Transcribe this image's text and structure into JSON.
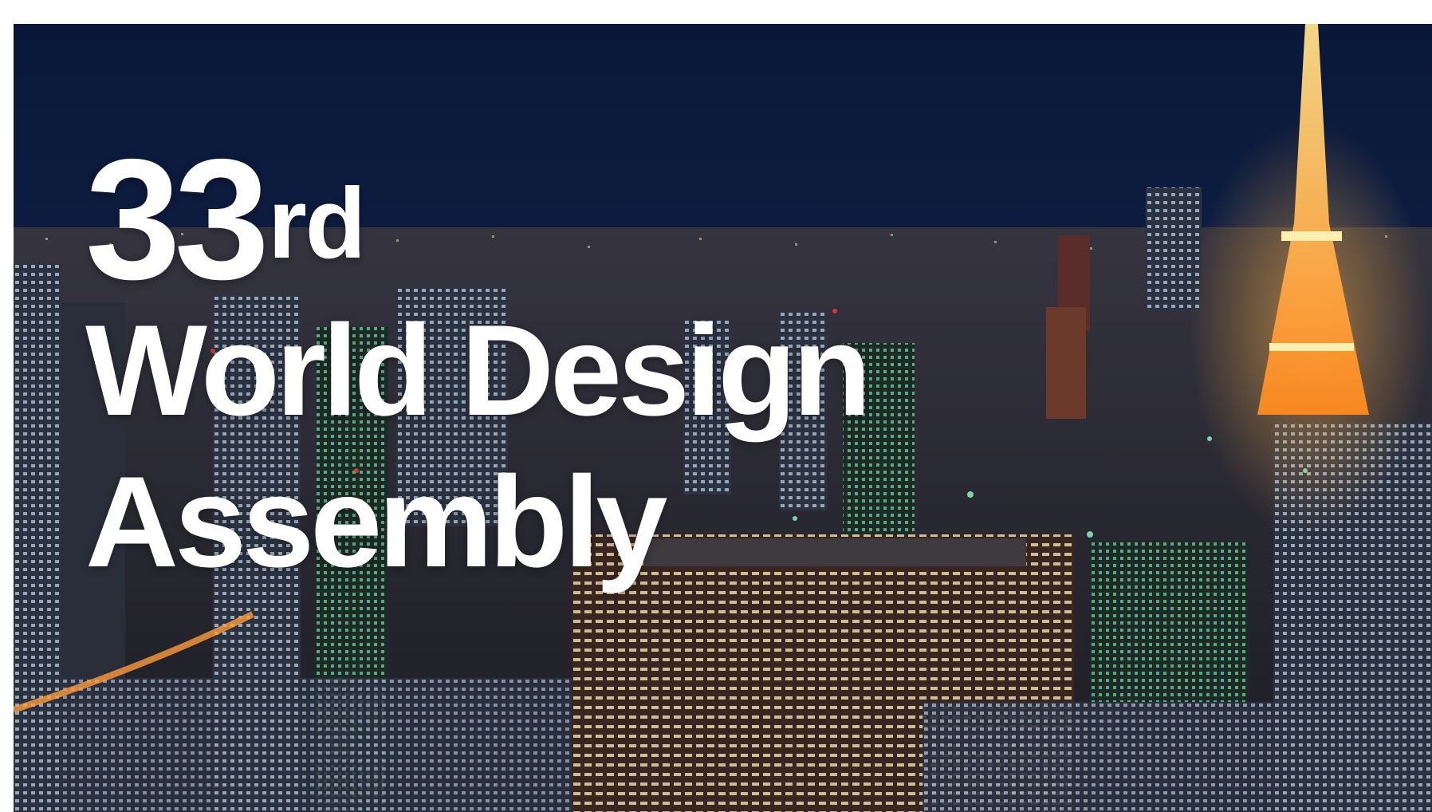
{
  "headline": {
    "number": "33",
    "ordinal": "rd",
    "line1": "World Design",
    "line2": "Assembly"
  },
  "scene": {
    "description_icon": "tokyo-night-skyline",
    "colors": {
      "sky_top": "#0a1738",
      "sky_horizon": "#1d3a6a",
      "city": "#2a2a3a",
      "tower": "#ff9b2a",
      "lights": "#ffd58a",
      "green_lights": "#6dffb0",
      "red_lights": "#ff3b30"
    }
  }
}
